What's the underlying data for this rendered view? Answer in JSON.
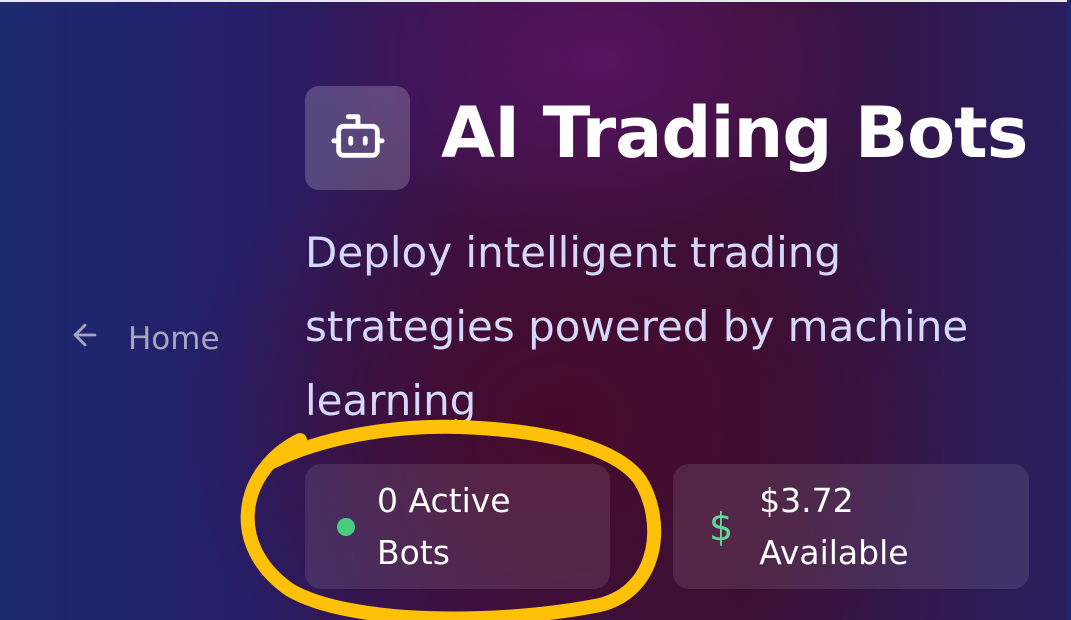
{
  "nav": {
    "back_label": "Home",
    "back_icon": "arrow-left-icon"
  },
  "header": {
    "logo_icon": "robot-icon",
    "title": "AI Trading Bots",
    "subtitle": "Deploy intelligent trading strategies powered by machine learning"
  },
  "stats": {
    "active_bots": {
      "line1": "0 Active",
      "line2": "Bots",
      "status_color": "#45cd7c"
    },
    "balance": {
      "icon": "dollar-icon",
      "line1": "$3.72",
      "line2": "Available",
      "icon_color": "#5fd89a"
    }
  },
  "annotation": {
    "highlight_color": "#ffc107"
  }
}
